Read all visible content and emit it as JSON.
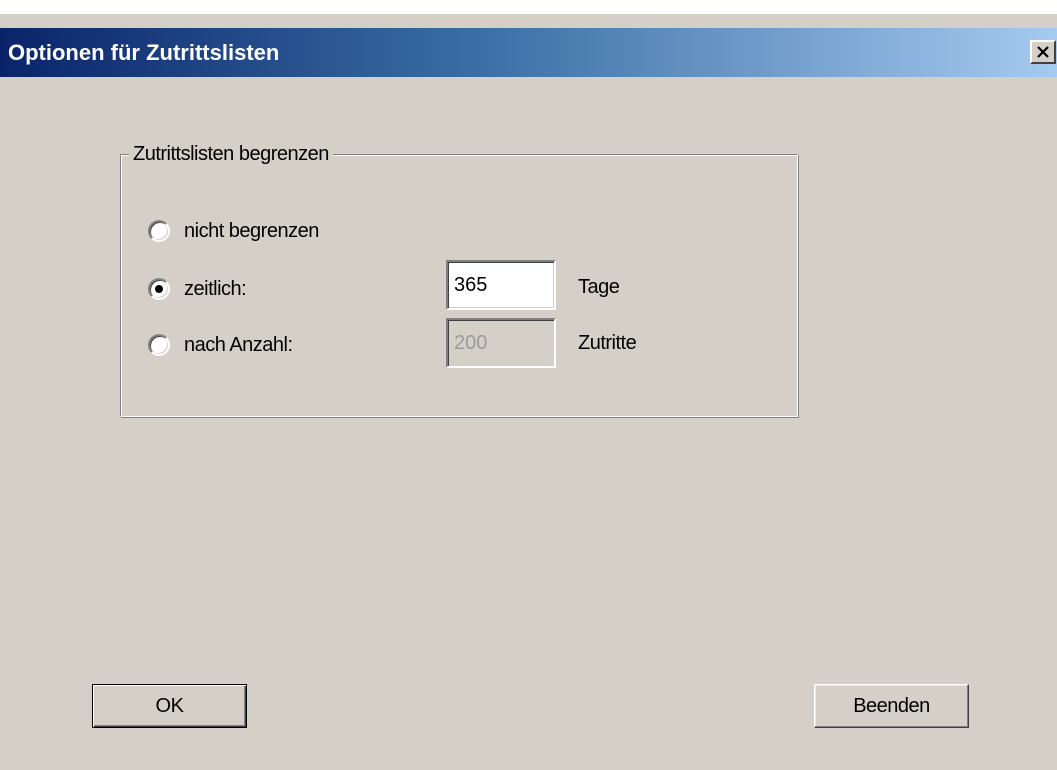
{
  "window": {
    "title": "Optionen für Zutrittslisten",
    "close_icon": "close-icon"
  },
  "group": {
    "legend": "Zutrittslisten begrenzen",
    "options": [
      {
        "label": "nicht begrenzen",
        "selected": false
      },
      {
        "label": "zeitlich:",
        "selected": true,
        "value": "365",
        "unit": "Tage",
        "enabled": true
      },
      {
        "label": "nach Anzahl:",
        "selected": false,
        "value": "200",
        "unit": "Zutritte",
        "enabled": false
      }
    ]
  },
  "buttons": {
    "ok_label": "OK",
    "quit_label": "Beenden"
  },
  "colors": {
    "dialog_background": "#d4d0c8",
    "titlebar_start": "#0a246a",
    "titlebar_end": "#a6caf0",
    "title_text": "#ffffff"
  }
}
